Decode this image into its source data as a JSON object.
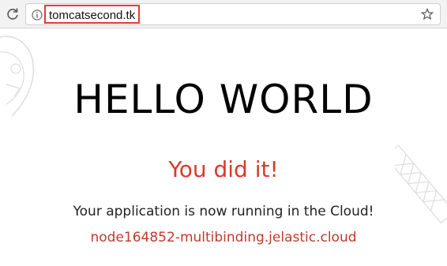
{
  "browser": {
    "url": "tomcatsecond.tk",
    "icons": {
      "reload": "reload-icon",
      "info": "info-icon",
      "bookmark": "star-icon"
    },
    "highlight_color": "#e53935"
  },
  "content": {
    "headline": "HELLO WORLD",
    "success": "You did it!",
    "message": "Your application is now running in the Cloud!",
    "node_host": "node164852-multibinding.jelastic.cloud"
  },
  "colors": {
    "accent": "#d93a2b",
    "link": "#c0392b",
    "text": "#000000"
  }
}
